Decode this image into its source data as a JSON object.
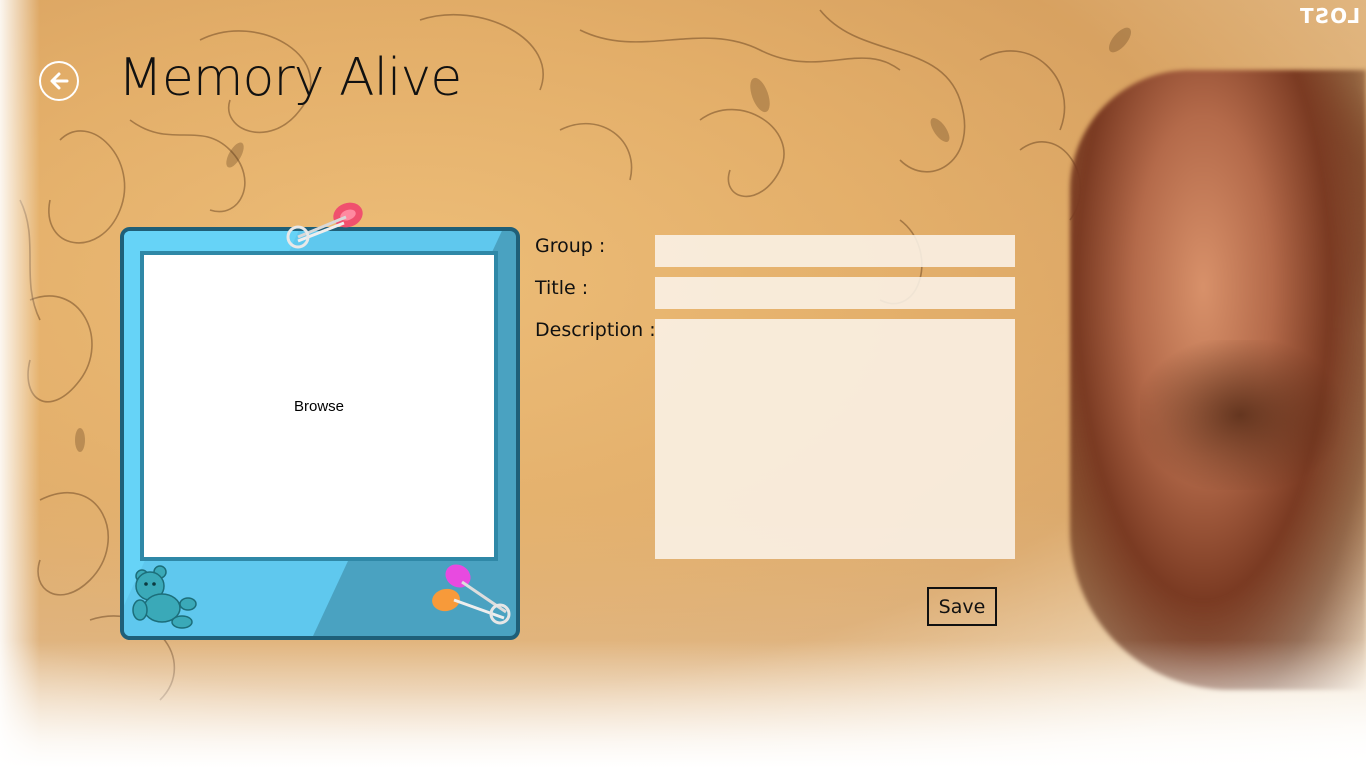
{
  "app": {
    "title": "Memory Alive",
    "corner_text": "LOST"
  },
  "navigation": {
    "back_icon": "back-arrow-circle-icon"
  },
  "image_frame": {
    "browse_label": "Browse",
    "decorations": [
      "safety-pin-icon",
      "teddy-bear-icon",
      "safety-pins-icon"
    ]
  },
  "form": {
    "group_label": "Group :",
    "group_value": "",
    "title_label": "Title :",
    "title_value": "",
    "description_label": "Description :",
    "description_value": "",
    "save_label": "Save"
  },
  "colors": {
    "frame_blue": "#4aa2c1",
    "frame_light_blue": "#66d3f7",
    "frame_border": "#1f5f78",
    "field_bg": "#faf2e8"
  }
}
